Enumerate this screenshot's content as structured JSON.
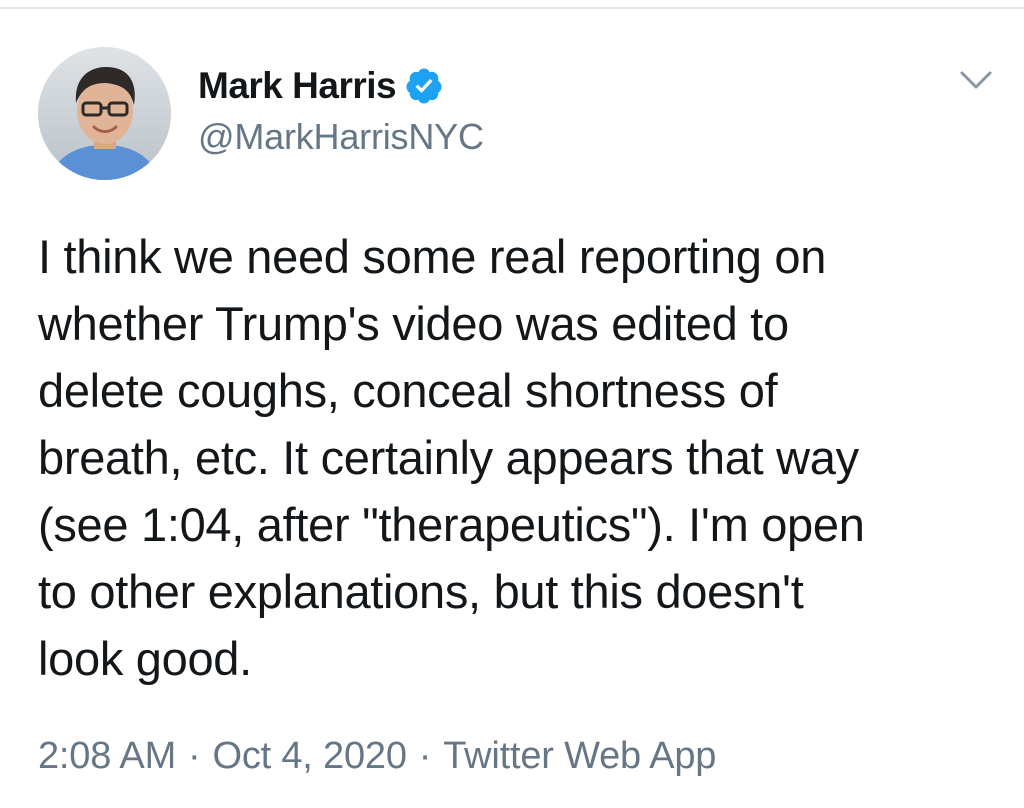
{
  "tweet": {
    "author": {
      "display_name": "Mark Harris",
      "handle": "@MarkHarrisNYC",
      "verified": true,
      "avatar_icon": "profile-photo"
    },
    "text": "I think we need some real reporting on\nwhether Trump's video was edited to\ndelete coughs, conceal shortness of\nbreath, etc. It certainly appears that way\n(see 1:04, after \"therapeutics\"). I'm open\nto other explanations, but this doesn't\nlook good.",
    "time": "2:08 AM",
    "date": "Oct 4, 2020",
    "separator": "·",
    "source": "Twitter Web App",
    "menu_icon": "chevron-down-icon"
  },
  "colors": {
    "text_primary": "#14171a",
    "text_secondary": "#657786",
    "verified_blue": "#1da1f2",
    "divider": "#e1e8ed"
  }
}
